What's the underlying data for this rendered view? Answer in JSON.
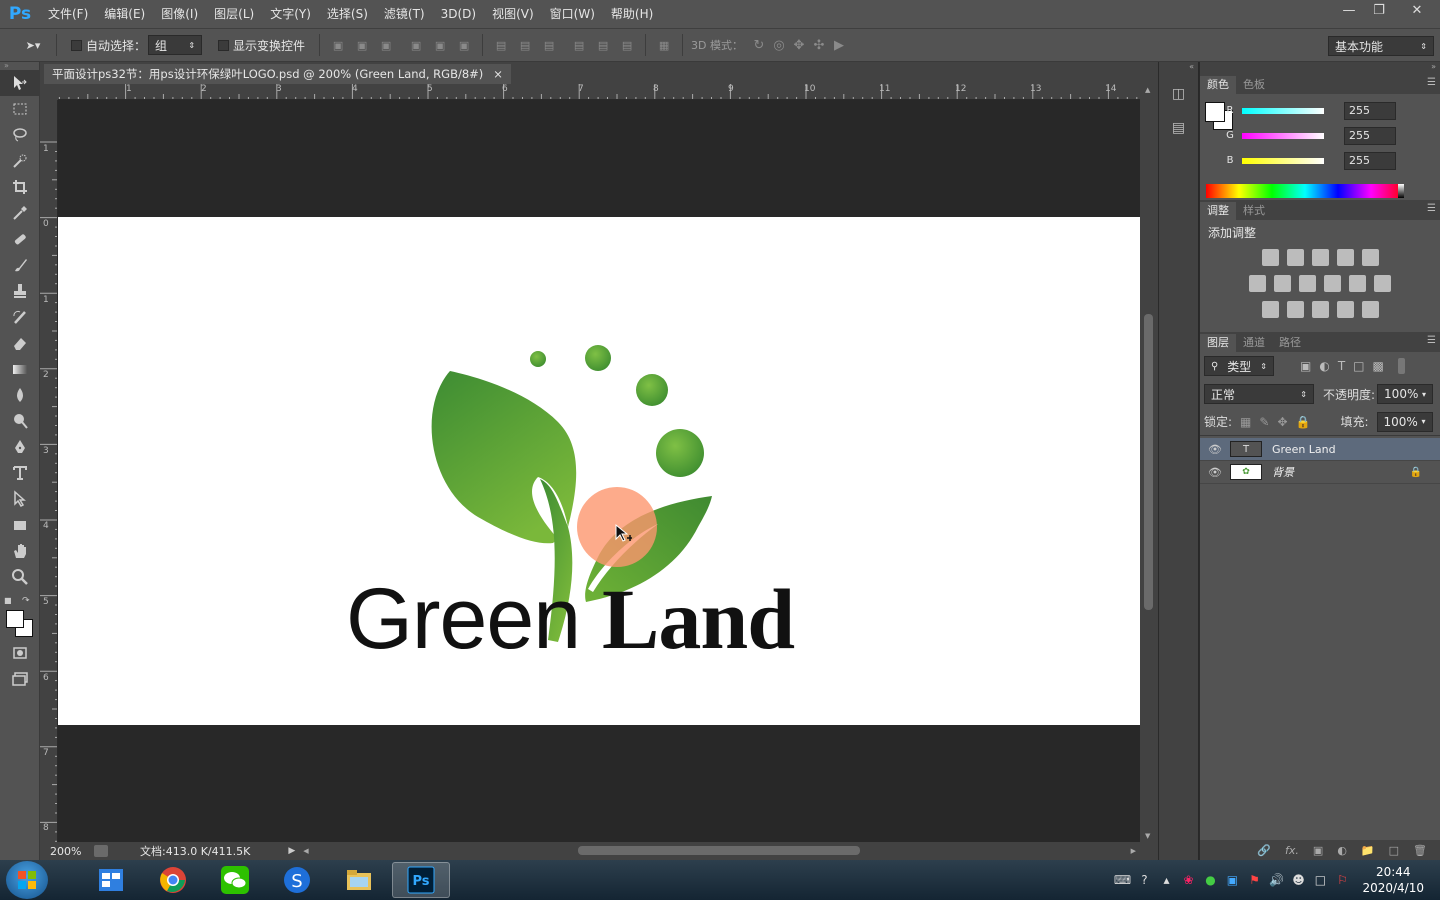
{
  "app": {
    "logo": "Ps"
  },
  "menu": [
    "文件(F)",
    "编辑(E)",
    "图像(I)",
    "图层(L)",
    "文字(Y)",
    "选择(S)",
    "滤镜(T)",
    "3D(D)",
    "视图(V)",
    "窗口(W)",
    "帮助(H)"
  ],
  "options": {
    "auto_select_label": "自动选择：",
    "auto_select_value": "组",
    "show_transform_label": "显示变换控件",
    "mode_3d_label": "3D 模式：",
    "workspace": "基本功能"
  },
  "document": {
    "tab_title": "平面设计ps32节：用ps设计环保绿叶LOGO.psd @ 200% (Green Land, RGB/8#)",
    "tab_close": "×",
    "logo_word1": "Green",
    "logo_word2": "Land"
  },
  "rulers": {
    "h": [
      "1",
      "2",
      "3",
      "4",
      "5",
      "6",
      "7",
      "8",
      "9",
      "10",
      "11",
      "12",
      "13",
      "14"
    ],
    "v": [
      "1",
      "0",
      "1",
      "2",
      "3",
      "4",
      "5",
      "6",
      "7",
      "8"
    ]
  },
  "status": {
    "zoom": "200%",
    "doc_info": "文档:413.0 K/411.5K"
  },
  "color_panel": {
    "tabs": [
      "颜色",
      "色板"
    ],
    "r_label": "R",
    "g_label": "G",
    "b_label": "B",
    "r": "255",
    "g": "255",
    "b": "255"
  },
  "adjust_panel": {
    "tabs": [
      "调整",
      "样式"
    ],
    "title": "添加调整"
  },
  "layers_panel": {
    "tabs": [
      "图层",
      "通道",
      "路径"
    ],
    "filter_kind": "类型",
    "blend_mode": "正常",
    "opacity_label": "不透明度:",
    "opacity": "100%",
    "lock_label": "锁定:",
    "fill_label": "填充:",
    "fill": "100%",
    "layers": [
      {
        "name": "Green Land",
        "type": "text",
        "selected": true
      },
      {
        "name": "背景",
        "type": "image",
        "selected": false
      }
    ]
  },
  "taskbar": {
    "time": "20:44",
    "date": "2020/4/10"
  }
}
